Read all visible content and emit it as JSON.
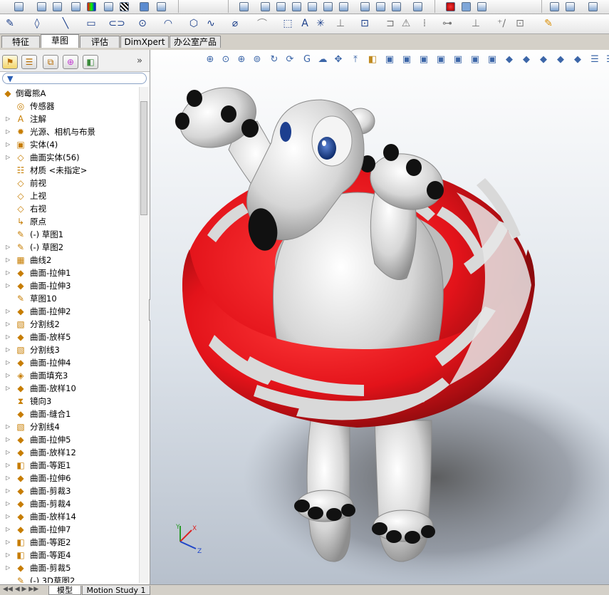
{
  "toolbar": {
    "row2_icons": [
      "sketch-icon",
      "smart-dimension-icon",
      "line-icon",
      "rectangle-icon",
      "slot-icon",
      "circle-icon",
      "arc-icon",
      "polygon-icon",
      "spline-icon",
      "plane-icon",
      "text-icon",
      "point-icon",
      "trim-icon",
      "convert-entities-icon",
      "offset-icon",
      "mirror-icon",
      "linear-pattern-icon",
      "move-icon",
      "relations-icon",
      "repair-icon",
      "quick-snaps-icon",
      "rapid-sketch-icon"
    ]
  },
  "tabs": [
    {
      "label": "特征",
      "active": false
    },
    {
      "label": "草图",
      "active": true
    },
    {
      "label": "评估",
      "active": false
    },
    {
      "label": "DimXpert",
      "active": false
    },
    {
      "label": "办公室产品",
      "active": false
    }
  ],
  "panel": {
    "tabs": [
      "feature-manager-icon",
      "property-manager-icon",
      "configuration-manager-icon",
      "dimxpert-manager-icon",
      "display-manager-icon"
    ],
    "expand_symbol": "»",
    "filter_icon": "▼"
  },
  "tree": [
    {
      "label": "倒霉熊A",
      "icon": "◆",
      "expand": false,
      "root": true
    },
    {
      "label": "传感器",
      "icon": "◎",
      "expand": false
    },
    {
      "label": "注解",
      "icon": "A",
      "expand": true
    },
    {
      "label": "光源、相机与布景",
      "icon": "✹",
      "expand": true
    },
    {
      "label": "实体(4)",
      "icon": "▣",
      "expand": true
    },
    {
      "label": "曲面实体(56)",
      "icon": "◇",
      "expand": true
    },
    {
      "label": "材质 <未指定>",
      "icon": "☷",
      "expand": false
    },
    {
      "label": "前视",
      "icon": "◇",
      "expand": false
    },
    {
      "label": "上视",
      "icon": "◇",
      "expand": false
    },
    {
      "label": "右视",
      "icon": "◇",
      "expand": false
    },
    {
      "label": "原点",
      "icon": "↳",
      "expand": false
    },
    {
      "label": "(-) 草图1",
      "icon": "✎",
      "expand": false
    },
    {
      "label": "(-) 草图2",
      "icon": "✎",
      "expand": true
    },
    {
      "label": "曲线2",
      "icon": "▦",
      "expand": true
    },
    {
      "label": "曲面-拉伸1",
      "icon": "◆",
      "expand": true
    },
    {
      "label": "曲面-拉伸3",
      "icon": "◆",
      "expand": true
    },
    {
      "label": "草图10",
      "icon": "✎",
      "expand": false
    },
    {
      "label": "曲面-拉伸2",
      "icon": "◆",
      "expand": true
    },
    {
      "label": "分割线2",
      "icon": "▧",
      "expand": true
    },
    {
      "label": "曲面-放样5",
      "icon": "◆",
      "expand": true
    },
    {
      "label": "分割线3",
      "icon": "▧",
      "expand": true
    },
    {
      "label": "曲面-拉伸4",
      "icon": "◆",
      "expand": true
    },
    {
      "label": "曲面填充3",
      "icon": "◈",
      "expand": true
    },
    {
      "label": "曲面-放样10",
      "icon": "◆",
      "expand": true
    },
    {
      "label": "镜向3",
      "icon": "⧗",
      "expand": false
    },
    {
      "label": "曲面-缝合1",
      "icon": "◆",
      "expand": false
    },
    {
      "label": "分割线4",
      "icon": "▧",
      "expand": true
    },
    {
      "label": "曲面-拉伸5",
      "icon": "◆",
      "expand": true
    },
    {
      "label": "曲面-放样12",
      "icon": "◆",
      "expand": true
    },
    {
      "label": "曲面-等距1",
      "icon": "◧",
      "expand": true
    },
    {
      "label": "曲面-拉伸6",
      "icon": "◆",
      "expand": true
    },
    {
      "label": "曲面-剪裁3",
      "icon": "◆",
      "expand": true
    },
    {
      "label": "曲面-剪裁4",
      "icon": "◆",
      "expand": true
    },
    {
      "label": "曲面-放样14",
      "icon": "◆",
      "expand": true
    },
    {
      "label": "曲面-拉伸7",
      "icon": "◆",
      "expand": true
    },
    {
      "label": "曲面-等距2",
      "icon": "◧",
      "expand": true
    },
    {
      "label": "曲面-等距4",
      "icon": "◧",
      "expand": true
    },
    {
      "label": "曲面-剪裁5",
      "icon": "◆",
      "expand": true
    },
    {
      "label": "(-) 3D草图2",
      "icon": "✎",
      "expand": false
    }
  ],
  "bottom_tabs": [
    {
      "label": "模型",
      "active": true
    },
    {
      "label": "Motion Study 1",
      "active": false
    }
  ],
  "colors": {
    "ring_red": "#e8141b",
    "bear_white": "#e6e6e6",
    "claw_black": "#111111",
    "eye_blue": "#1d3f8f"
  },
  "triad": {
    "x": "X",
    "y": "Y",
    "z": "Z"
  }
}
